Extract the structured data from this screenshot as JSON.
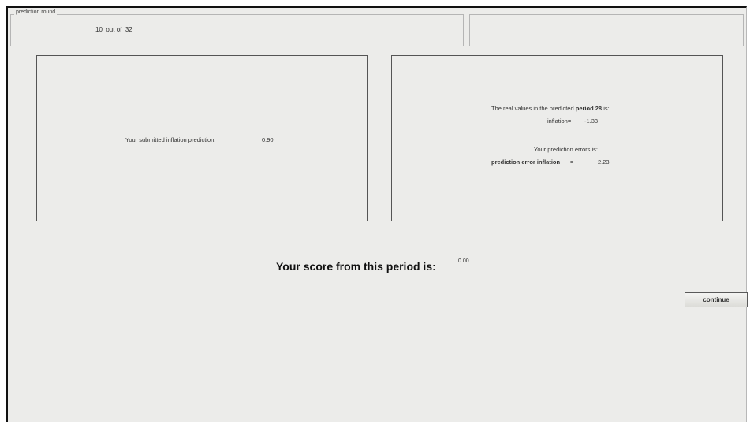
{
  "round_box": {
    "legend": "prediction round",
    "current": "10",
    "out_of_label": "out of",
    "total": "32"
  },
  "submitted": {
    "label": "Your submitted inflation prediction:",
    "value": "0.90"
  },
  "real_values": {
    "heading_prefix": "The real values in the predicted",
    "heading_period": "period 28",
    "heading_suffix": "is:",
    "inflation_label": "inflation=",
    "inflation_value": "-1.33",
    "errors_heading": "Your prediction errors is:",
    "error_label": "prediction error inflation",
    "error_equals": "=",
    "error_value": "2.23"
  },
  "score": {
    "label": "Your score from this period is:",
    "value": "0.00"
  },
  "buttons": {
    "continue": "continue"
  }
}
